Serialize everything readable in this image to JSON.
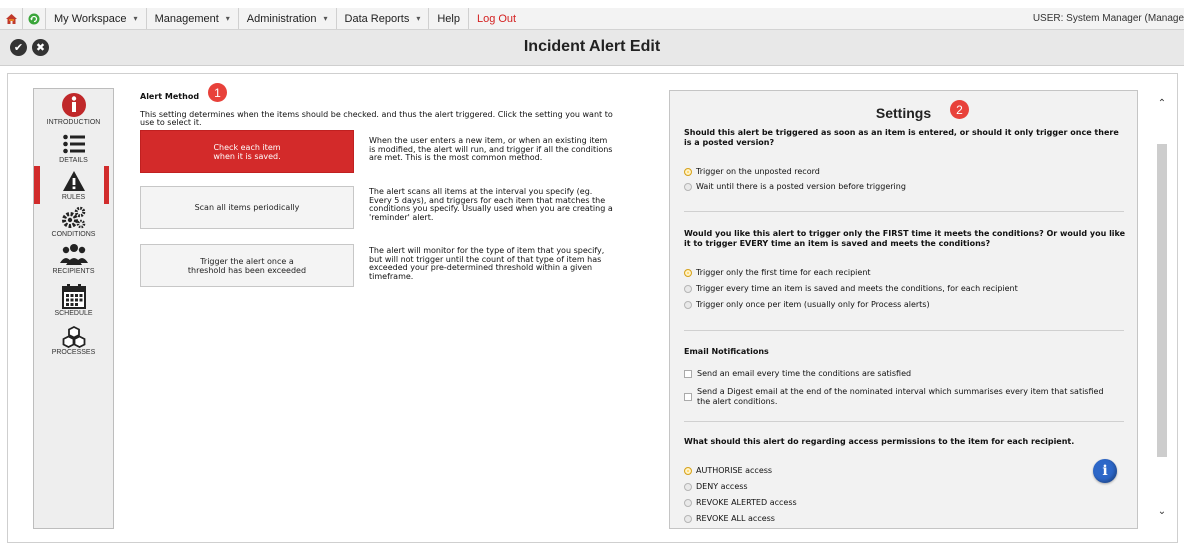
{
  "menubar": {
    "home_icon": "home-icon",
    "refresh_icon": "refresh-icon",
    "items": [
      {
        "label": "My Workspace",
        "caret": "▾"
      },
      {
        "label": "Management",
        "caret": "▾"
      },
      {
        "label": "Administration",
        "caret": "▾"
      },
      {
        "label": "Data Reports",
        "caret": "▾"
      },
      {
        "label": "Help",
        "caret": ""
      }
    ],
    "logout": "Log Out",
    "user": "USER: System Manager (Manage"
  },
  "titlebar": {
    "title": "Incident Alert Edit",
    "save_glyph": "✔",
    "cancel_glyph": "✖"
  },
  "sidebar": {
    "active_color": "#d12c2c",
    "items": [
      {
        "label": "INTRODUCTION",
        "icon": "info-icon"
      },
      {
        "label": "DETAILS",
        "icon": "list-icon"
      },
      {
        "label": "RULES",
        "icon": "warning-icon"
      },
      {
        "label": "CONDITIONS",
        "icon": "gears-icon"
      },
      {
        "label": "RECIPIENTS",
        "icon": "people-icon"
      },
      {
        "label": "SCHEDULE",
        "icon": "calendar-icon"
      },
      {
        "label": "PROCESSES",
        "icon": "cubes-icon"
      }
    ]
  },
  "alert_method": {
    "title": "Alert Method",
    "badge": "1",
    "description": "This setting determines when the items should be checked. and thus the alert triggered. Click the setting you want to use to select it.",
    "options": [
      {
        "label": "Check each item\nwhen it is saved.",
        "active": true,
        "description": "When the user enters a new item, or when an existing item is modified, the alert will run, and trigger if all the conditions are met. This is the most common method."
      },
      {
        "label": "Scan all items periodically",
        "active": false,
        "description": "The alert scans all items at the interval you specify (eg. Every 5 days), and triggers for each item that matches the conditions you specify. Usually used when you are creating a 'reminder' alert."
      },
      {
        "label": "Trigger the alert once a\nthreshold has been exceeded",
        "active": false,
        "description": "The alert will monitor for the type of item that you specify, but will not trigger until the count of that type of item has exceeded your pre-determined threshold within a given timeframe."
      }
    ]
  },
  "settings": {
    "title": "Settings",
    "badge": "2",
    "q1": "Should this alert be triggered as soon as an item is entered, or should it only trigger once there is a posted version?",
    "q1_options": [
      {
        "label": "Trigger on the unposted record",
        "selected": true
      },
      {
        "label": "Wait until there is a posted version before triggering",
        "selected": false
      }
    ],
    "q2": "Would you like this alert to trigger only the FIRST time it meets the conditions? Or would you like it to trigger EVERY time an item is saved and meets the conditions?",
    "q2_options": [
      {
        "label": "Trigger only the first time for each recipient",
        "selected": true
      },
      {
        "label": "Trigger every time an item is saved and meets the conditions, for each recipient",
        "selected": false
      },
      {
        "label": "Trigger only once per item (usually only for Process alerts)",
        "selected": false
      }
    ],
    "email_title": "Email Notifications",
    "email_options": [
      {
        "label": "Send an email every time the conditions are satisfied",
        "checked": false
      },
      {
        "label": "Send a Digest email at the end of the nominated interval which summarises every item that satisfied the alert conditions.",
        "checked": false
      }
    ],
    "q3": "What should this alert do regarding access permissions to the item for each recipient.",
    "q3_options": [
      {
        "label": "AUTHORISE access",
        "selected": true
      },
      {
        "label": "DENY access",
        "selected": false
      },
      {
        "label": "REVOKE ALERTED access",
        "selected": false
      },
      {
        "label": "REVOKE ALL access",
        "selected": false
      }
    ],
    "info_glyph": "i"
  },
  "scrollbar": {
    "up": "⌃",
    "down": "⌄"
  }
}
